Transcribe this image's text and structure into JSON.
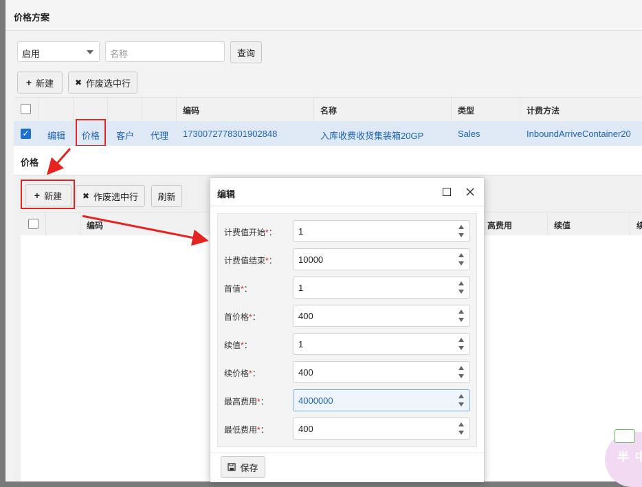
{
  "page": {
    "title": "价格方案"
  },
  "filter": {
    "status_selected": "启用",
    "name_placeholder": "名称",
    "query_label": "查询"
  },
  "toolbar": {
    "new_label": "新建",
    "void_label": "作废选中行"
  },
  "table": {
    "headers": [
      "编码",
      "名称",
      "类型",
      "计费方法"
    ],
    "row": {
      "actions": [
        "编辑",
        "价格",
        "客户",
        "代理"
      ],
      "code": "1730072778301902848",
      "name": "入库收费收货集装箱20GP",
      "type": "Sales",
      "method": "InboundArriveContainer20"
    }
  },
  "price_dialog": {
    "title": "价格",
    "toolbar": {
      "new_label": "新建",
      "void_label": "作废选中行",
      "refresh_label": "刷新"
    },
    "headers": {
      "code": "编码",
      "fee_partial": "高费用",
      "cont_value": "续值",
      "cont_partial": "续"
    }
  },
  "edit_dialog": {
    "title": "编辑",
    "fields": [
      {
        "label": "计费值开始",
        "value": "1"
      },
      {
        "label": "计费值结束",
        "value": "10000"
      },
      {
        "label": "首值",
        "value": "1"
      },
      {
        "label": "首价格",
        "value": "400"
      },
      {
        "label": "续值",
        "value": "1"
      },
      {
        "label": "续价格",
        "value": "400"
      },
      {
        "label": "最高费用",
        "value": "4000000"
      },
      {
        "label": "最低费用",
        "value": "400"
      }
    ],
    "save_label": "保存",
    "required_mark": "*",
    "colon": "："
  },
  "watermark": {
    "text": "半 中"
  },
  "colors": {
    "link": "#1d63b8",
    "annotation_red": "#e5231f",
    "checkbox_blue": "#1f6fd1"
  }
}
